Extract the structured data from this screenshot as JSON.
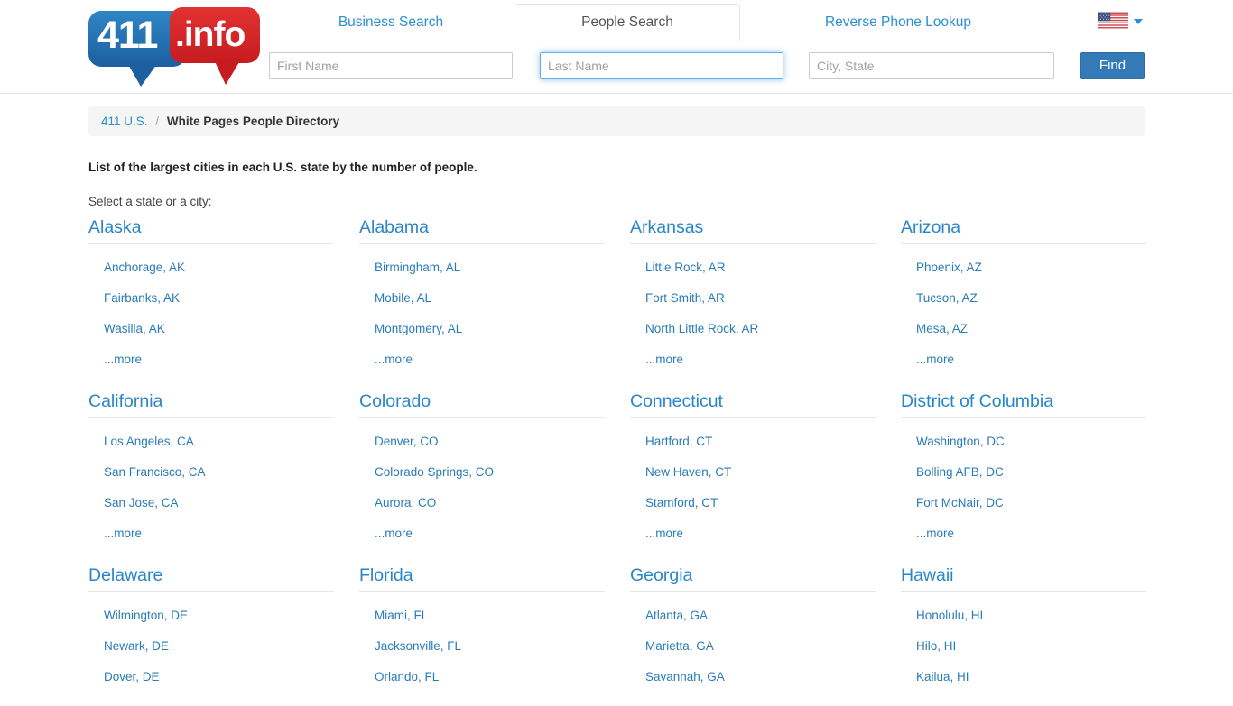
{
  "header": {
    "logo": {
      "primary": "411",
      "suffix": ".info",
      "alt": "411.info logo"
    },
    "tabs": [
      {
        "label": "Business Search",
        "active": false
      },
      {
        "label": "People Search",
        "active": true
      },
      {
        "label": "Reverse Phone Lookup",
        "active": false
      }
    ],
    "search": {
      "first_name_placeholder": "First Name",
      "first_name_value": "",
      "last_name_placeholder": "Last Name",
      "last_name_value": "",
      "city_state_placeholder": "City, State",
      "city_state_value": "",
      "find_label": "Find"
    },
    "locale": {
      "flag": "us-flag-icon",
      "caret": "chevron-down-icon"
    }
  },
  "breadcrumb": {
    "home": "411 U.S.",
    "separator": "/",
    "current": "White Pages People Directory"
  },
  "main": {
    "heading": "List of the largest cities in each U.S. state by the number of people.",
    "subheading": "Select a state or a city:",
    "more_label": "...more",
    "states": [
      {
        "name": "Alaska",
        "cities": [
          "Anchorage, AK",
          "Fairbanks, AK",
          "Wasilla, AK"
        ],
        "has_more": true
      },
      {
        "name": "Alabama",
        "cities": [
          "Birmingham, AL",
          "Mobile, AL",
          "Montgomery, AL"
        ],
        "has_more": true
      },
      {
        "name": "Arkansas",
        "cities": [
          "Little Rock, AR",
          "Fort Smith, AR",
          "North Little Rock, AR"
        ],
        "has_more": true
      },
      {
        "name": "Arizona",
        "cities": [
          "Phoenix, AZ",
          "Tucson, AZ",
          "Mesa, AZ"
        ],
        "has_more": true
      },
      {
        "name": "California",
        "cities": [
          "Los Angeles, CA",
          "San Francisco, CA",
          "San Jose, CA"
        ],
        "has_more": true
      },
      {
        "name": "Colorado",
        "cities": [
          "Denver, CO",
          "Colorado Springs, CO",
          "Aurora, CO"
        ],
        "has_more": true
      },
      {
        "name": "Connecticut",
        "cities": [
          "Hartford, CT",
          "New Haven, CT",
          "Stamford, CT"
        ],
        "has_more": true
      },
      {
        "name": "District of Columbia",
        "cities": [
          "Washington, DC",
          "Bolling AFB, DC",
          "Fort McNair, DC"
        ],
        "has_more": true
      },
      {
        "name": "Delaware",
        "cities": [
          "Wilmington, DE",
          "Newark, DE",
          "Dover, DE"
        ],
        "has_more": false
      },
      {
        "name": "Florida",
        "cities": [
          "Miami, FL",
          "Jacksonville, FL",
          "Orlando, FL"
        ],
        "has_more": false
      },
      {
        "name": "Georgia",
        "cities": [
          "Atlanta, GA",
          "Marietta, GA",
          "Savannah, GA"
        ],
        "has_more": false
      },
      {
        "name": "Hawaii",
        "cities": [
          "Honolulu, HI",
          "Hilo, HI",
          "Kailua, HI"
        ],
        "has_more": false
      }
    ]
  },
  "colors": {
    "link_blue": "#2a7cb8",
    "heading_blue": "#2a86c8",
    "tab_blue": "#2a8fd0",
    "button_blue": "#337ab7",
    "logo_blue": "#1d5fa0",
    "logo_red": "#c61c20",
    "breadcrumb_bg": "#f5f5f5",
    "border_gray": "#e3e3e3"
  }
}
